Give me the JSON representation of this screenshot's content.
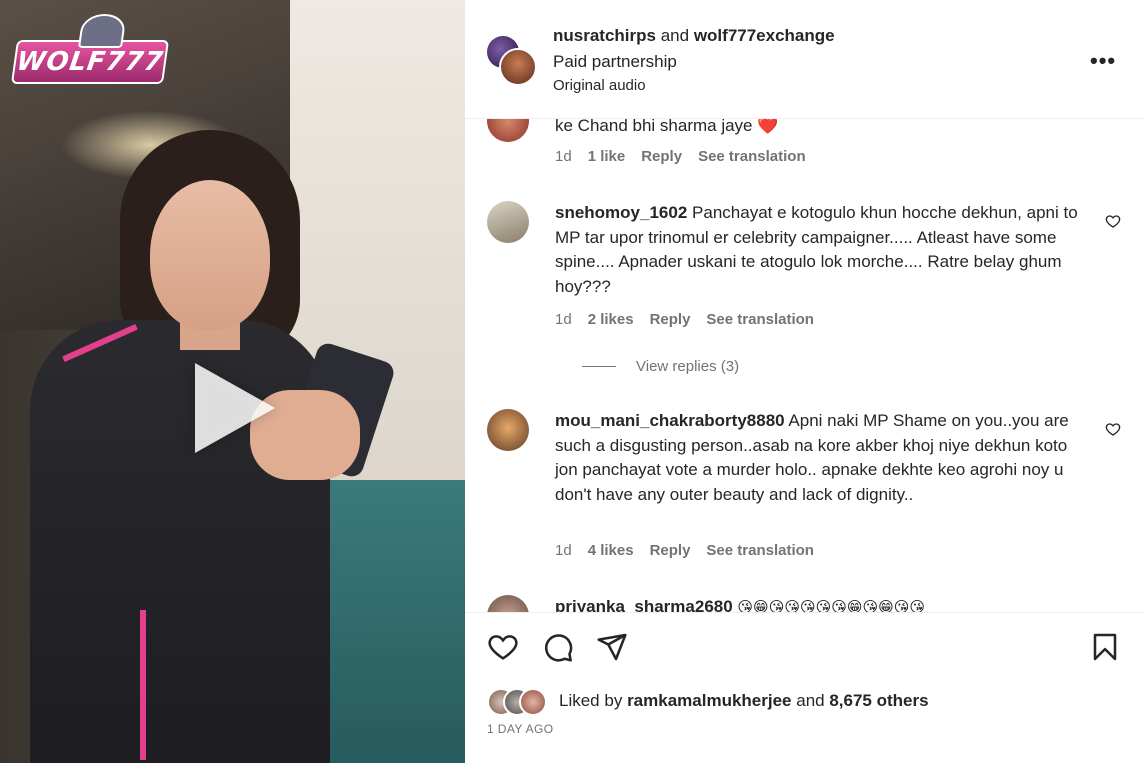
{
  "media": {
    "logo_text": "WOLF777"
  },
  "header": {
    "user1": "nusratchirps",
    "and_text": "and",
    "user2": "wolf777exchange",
    "subtitle": "Paid partnership",
    "audio": "Original audio"
  },
  "comments": [
    {
      "username": "",
      "text": "ke Chand bhi sharma jaye ❤️",
      "time": "1d",
      "likes": "1 like",
      "reply": "Reply",
      "translate": "See translation"
    },
    {
      "username": "snehomoy_1602",
      "text": "Panchayat e kotogulo khun hocche dekhun, apni to MP tar upor trinomul er celebrity campaigner..... Atleast have some spine.... Apnader uskani te atogulo lok morche.... Ratre belay ghum hoy???",
      "time": "1d",
      "likes": "2 likes",
      "reply": "Reply",
      "translate": "See translation",
      "view_replies": "View replies (3)"
    },
    {
      "username": "mou_mani_chakraborty8880",
      "text": "Apni naki MP Shame on you..you are such a disgusting person..asab na kore akber khoj niye dekhun koto jon panchayat vote a murder holo.. apnake dekhte keo agrohi noy u don't have any outer beauty and lack of dignity..",
      "time": "1d",
      "likes": "4 likes",
      "reply": "Reply",
      "translate": "See translation"
    },
    {
      "username": "priyanka_sharma2680",
      "text": "😘😁😘😘😘😘😘😁😘😁😘😘"
    }
  ],
  "likes": {
    "prefix": "Liked by",
    "user": "ramkamalmukherjee",
    "and_text": "and",
    "others": "8,675 others"
  },
  "time_ago": "1 DAY AGO",
  "colors": {
    "text": "#262626",
    "secondary": "#737373",
    "heart_red": "#ed1c24",
    "brand_pink": "#e23f8c"
  }
}
